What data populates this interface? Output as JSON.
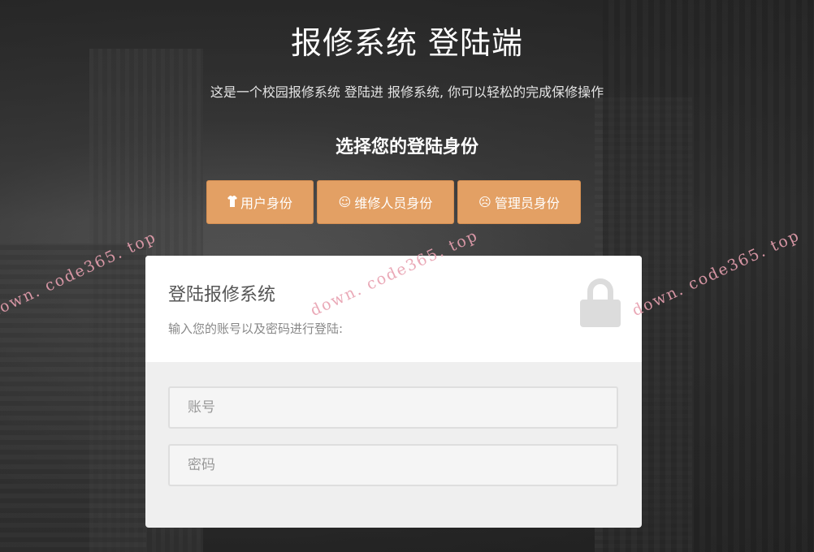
{
  "header": {
    "title": "报修系统 登陆端",
    "subtitle": "这是一个校园报修系统 登陆进 报修系统, 你可以轻松的完成保修操作",
    "choose_identity": "选择您的登陆身份"
  },
  "roles": [
    {
      "label": "用户身份",
      "icon": "shirt-icon"
    },
    {
      "label": "维修人员身份",
      "icon": "smile-icon"
    },
    {
      "label": "管理员身份",
      "icon": "neutral-face-icon"
    }
  ],
  "login_card": {
    "title": "登陆报修系统",
    "description": "输入您的账号以及密码进行登陆:",
    "account_placeholder": "账号",
    "password_placeholder": "密码"
  },
  "watermark": "down. code365. top",
  "colors": {
    "accent": "#e3a064",
    "card_bg": "#ffffff",
    "form_bg": "#efefef"
  }
}
